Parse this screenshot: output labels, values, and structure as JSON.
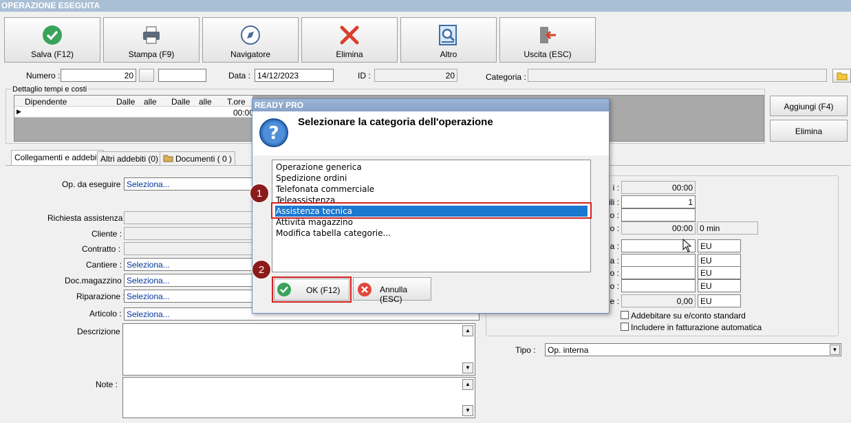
{
  "window": {
    "title": "OPERAZIONE ESEGUITA"
  },
  "toolbar": {
    "salva": "Salva (F12)",
    "stampa": "Stampa (F9)",
    "navigatore": "Navigatore",
    "elimina": "Elimina",
    "altro": "Altro",
    "uscita": "Uscita (ESC)"
  },
  "header": {
    "numero_label": "Numero :",
    "numero_value": "20",
    "data_label": "Data :",
    "data_value": "14/12/2023",
    "id_label": "ID :",
    "id_value": "20",
    "categoria_label": "Categoria :",
    "categoria_value": ""
  },
  "dettaglio": {
    "legend": "Dettaglio tempi e costi",
    "columns": [
      "Dipendente",
      "Dalle",
      "alle",
      "Dalle",
      "alle",
      "T.ore"
    ],
    "row_tore": "00:00",
    "aggiungi": "Aggiungi (F4)",
    "elimina": "Elimina"
  },
  "tabs": [
    "Collegamenti e addebiti",
    "Altri addebiti (0)",
    "Documenti ( 0 )"
  ],
  "form": {
    "op_label": "Op. da eseguire :",
    "op_value": "Seleziona...",
    "richiesta_label": "Richiesta assistenza :",
    "cliente_label": "Cliente :",
    "contratto_label": "Contratto :",
    "cantiere_label": "Cantiere :",
    "cantiere_value": "Seleziona...",
    "docmag_label": "Doc.magazzino :",
    "docmag_value": "Seleziona...",
    "riparazione_label": "Riparazione :",
    "riparazione_value": "Seleziona...",
    "articolo_label": "Articolo :",
    "articolo_value": "Seleziona...",
    "descrizione_label": "Descrizione :",
    "note_label": "Note :"
  },
  "rightpanel": {
    "r1_suffix": "i :",
    "r1_value": "00:00",
    "r2_suffix": "ili :",
    "r2_value": "1",
    "r3_suffix": "o :",
    "r4_suffix": "o :",
    "r4_value": "00:00",
    "r4_extra": "0 min",
    "r5_suffix": "a :",
    "r6_suffix": "a :",
    "r7_suffix": "o :",
    "r8_suffix": "o :",
    "r9_suffix": "e :",
    "r9_value": "0,00",
    "currency": "EU",
    "chk1": "Addebitare su e/conto standard",
    "chk2": "Includere in fatturazione automatica",
    "tipo_label": "Tipo :",
    "tipo_value": "Op. interna"
  },
  "dialog": {
    "title": "READY PRO",
    "heading": "Selezionare la categoria dell'operazione",
    "items": [
      "Operazione generica",
      "Spedizione ordini",
      "Telefonata commerciale",
      "Teleassistenza",
      "Assistenza tecnica",
      "Attività magazzino",
      "Modifica tabella categorie..."
    ],
    "selected_index": 4,
    "ok": "OK (F12)",
    "annulla": "Annulla (ESC)"
  },
  "markers": [
    "1",
    "2"
  ],
  "colors": {
    "selection": "#1b78d0",
    "highlight_box": "#d32020",
    "marker": "#8b1a1a"
  }
}
